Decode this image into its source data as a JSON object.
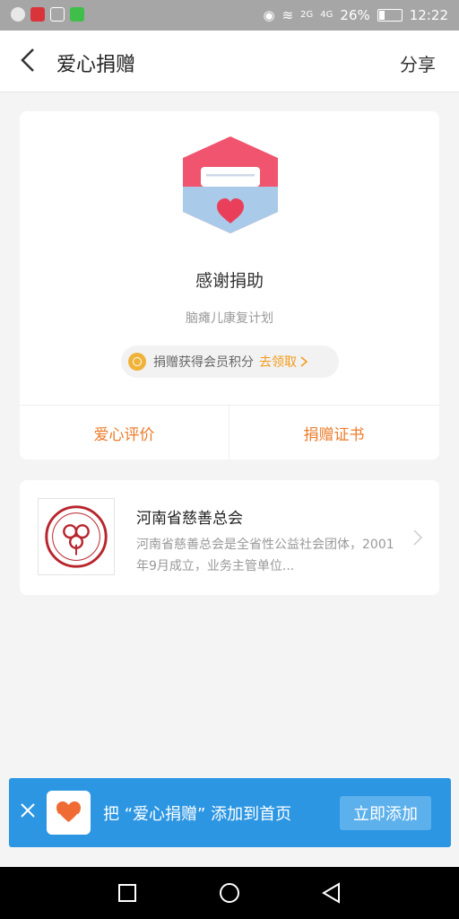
{
  "status_bar": {
    "network_2g": "2G",
    "network_4g": "4G",
    "battery": "26%",
    "time": "12:22"
  },
  "header": {
    "title": "爱心捐赠",
    "share_label": "分享"
  },
  "thanks_card": {
    "title": "感谢捐助",
    "project": "脑瘫儿康复计划",
    "points_text": "捐赠获得会员积分",
    "points_link": "去领取",
    "actions": [
      "爱心评价",
      "捐赠证书"
    ]
  },
  "organization": {
    "name": "河南省慈善总会",
    "description": "河南省慈善总会是全省性公益社会团体，2001年9月成立，业务主管单位..."
  },
  "promo": {
    "text": "把 “爱心捐赠” 添加到首页",
    "button": "立即添加"
  },
  "colors": {
    "accent_orange": "#ec7c2c",
    "link_orange": "#f39a19",
    "promo_blue": "#2c96e3",
    "logo_red": "#f0546e",
    "logo_blue": "#a9cbe9"
  }
}
